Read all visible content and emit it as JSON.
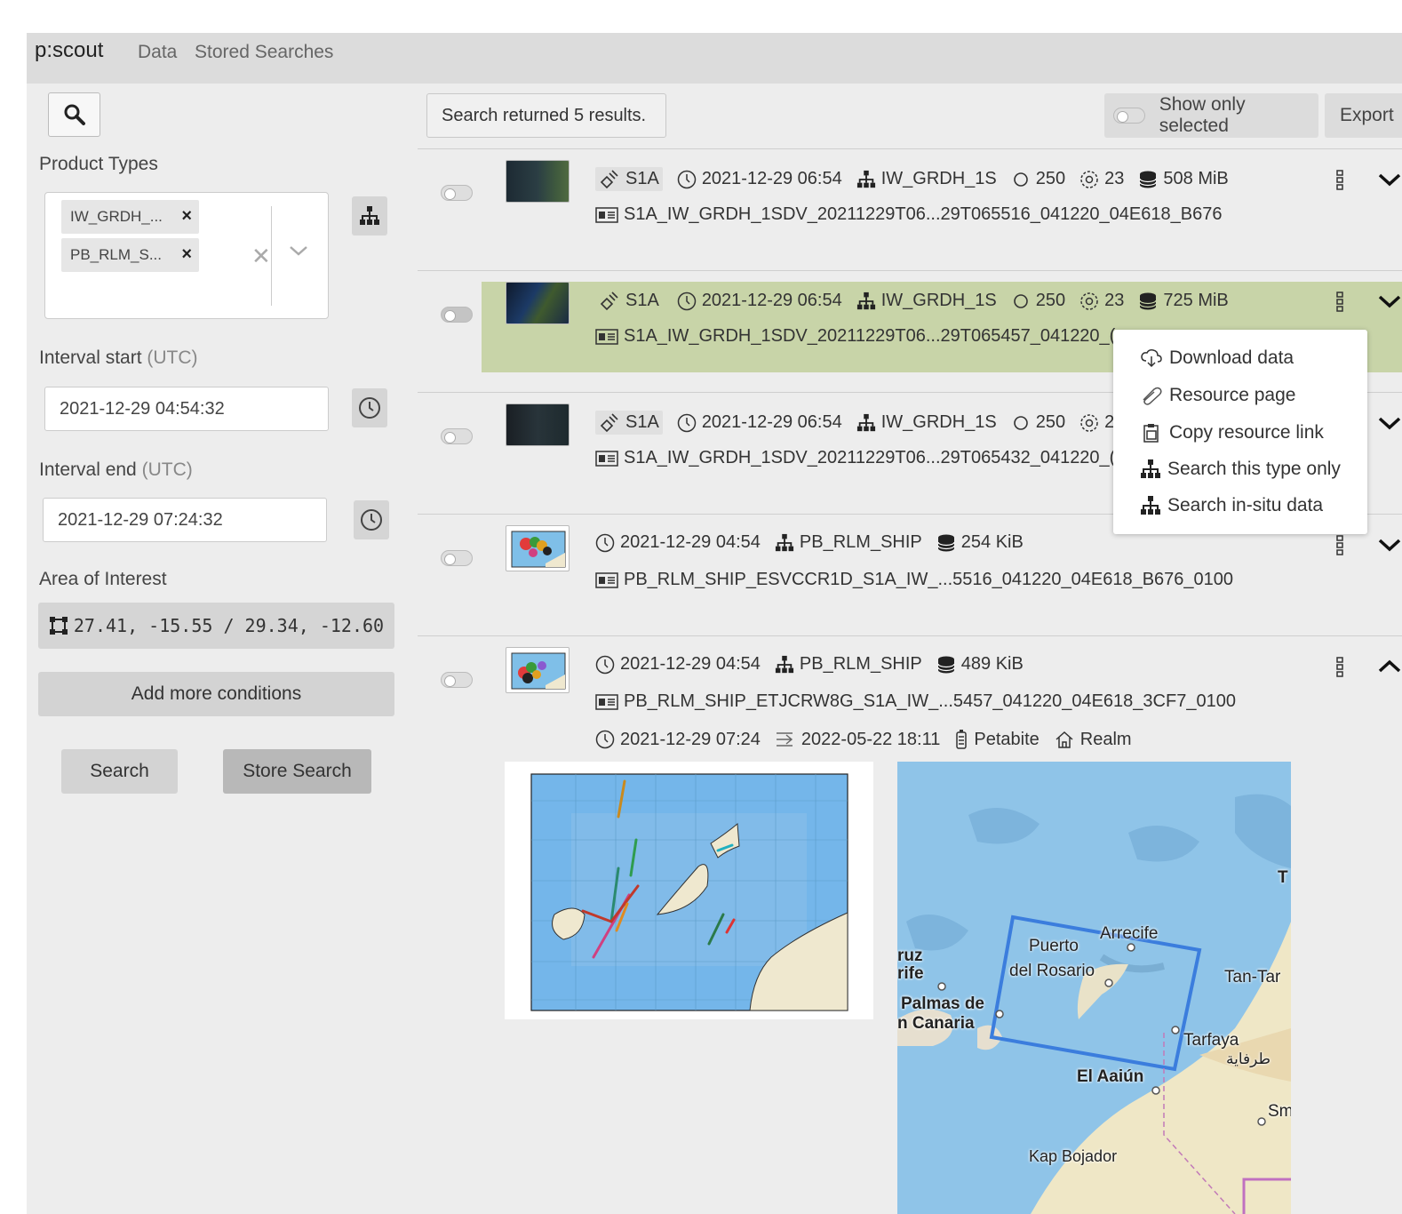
{
  "navbar": {
    "brand": "p:scout",
    "links": [
      "Data",
      "Stored Searches"
    ]
  },
  "sidebar": {
    "product_types_label": "Product Types",
    "chips": [
      "IW_GRDH_...",
      "PB_RLM_S..."
    ],
    "interval_start_label": "Interval start",
    "interval_end_label": "Interval end",
    "utc_suffix": "(UTC)",
    "interval_start": "2021-12-29 04:54:32",
    "interval_end": "2021-12-29 07:24:32",
    "aoi_label": "Area of Interest",
    "aoi_value": "27.41, -15.55 / 29.34, -12.60",
    "add_conditions": "Add more conditions",
    "search_button": "Search",
    "store_search_button": "Store Search"
  },
  "results": {
    "count_text": "Search returned 5 results.",
    "show_only_selected": "Show only selected",
    "export_label": "Export",
    "rows": [
      {
        "satellite": "S1A",
        "time": "2021-12-29 06:54",
        "type": "IW_GRDH_1S",
        "orbit": "250",
        "rel_orbit": "23",
        "size": "508 MiB",
        "name": "S1A_IW_GRDH_1SDV_20211229T06...29T065516_041220_04E618_B676"
      },
      {
        "satellite": "S1A",
        "time": "2021-12-29 06:54",
        "type": "IW_GRDH_1S",
        "orbit": "250",
        "rel_orbit": "23",
        "size": "725 MiB",
        "name": "S1A_IW_GRDH_1SDV_20211229T06...29T065457_041220_("
      },
      {
        "satellite": "S1A",
        "time": "2021-12-29 06:54",
        "type": "IW_GRDH_1S",
        "orbit": "250",
        "rel_orbit": "2",
        "name": "S1A_IW_GRDH_1SDV_20211229T06...29T065432_041220_("
      },
      {
        "time": "2021-12-29 04:54",
        "type": "PB_RLM_SHIP",
        "size": "254 KiB",
        "name": "PB_RLM_SHIP_ESVCCR1D_S1A_IW_...5516_041220_04E618_B676_0100"
      },
      {
        "time": "2021-12-29 04:54",
        "type": "PB_RLM_SHIP",
        "size": "489 KiB",
        "name": "PB_RLM_SHIP_ETJCRW8G_S1A_IW_...5457_041220_04E618_3CF7_0100",
        "detail_start": "2021-12-29 07:24",
        "detail_end": "2022-05-22 18:11",
        "storage": "Petabite",
        "realm": "Realm"
      }
    ]
  },
  "context_menu": {
    "items": [
      "Download data",
      "Resource page",
      "Copy resource link",
      "Search this type only",
      "Search in-situ data"
    ]
  },
  "map_labels": [
    "Arrecife",
    "Puerto",
    "del Rosario",
    "ruz",
    "rife",
    "Palmas de",
    "n Canaria",
    "Tan-Tar",
    "Tarfaya",
    "طرفاية",
    "El Aaiún",
    "Kap Bojador",
    "Sm",
    "T"
  ],
  "colors": {
    "selected_row": "#c8d4a8",
    "panel_bg": "#ededed",
    "nav_bg": "#dcdcdc",
    "aoi_box": "#3b7ddd"
  }
}
